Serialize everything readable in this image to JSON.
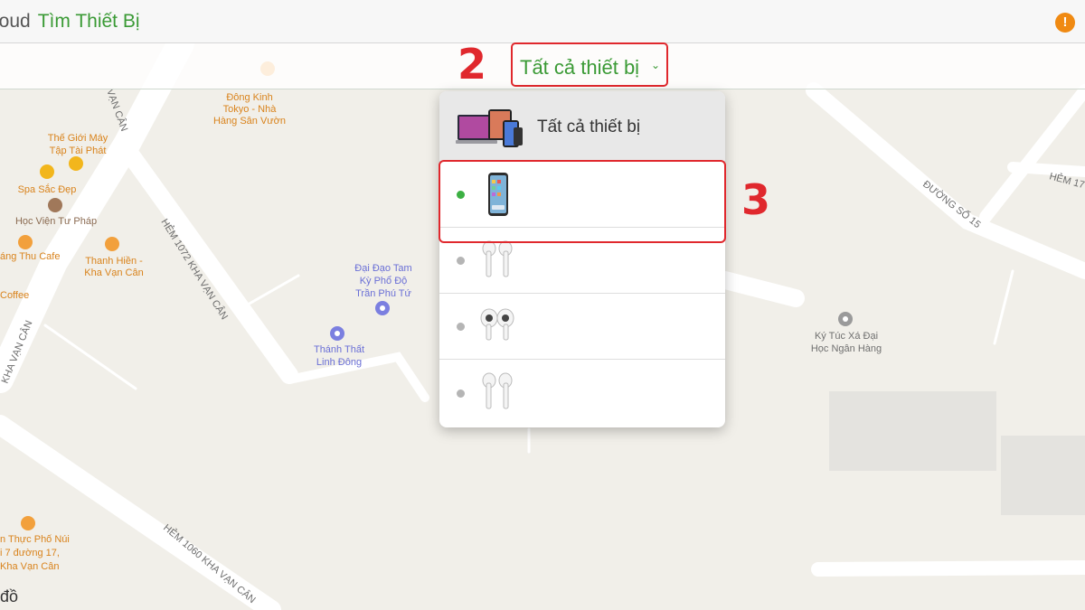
{
  "header": {
    "app_name": "loud",
    "section": "Tìm Thiết Bị",
    "alert_glyph": "!"
  },
  "device_selector": {
    "label": "Tất cả thiết bị",
    "chevron": "⌄"
  },
  "annotations": {
    "step2": "2",
    "step3": "3"
  },
  "dropdown": {
    "all_devices_label": "Tất cả thiết bị",
    "items": [
      {
        "icon": "iphone-icon",
        "status": "online"
      },
      {
        "icon": "airpods-icon",
        "status": "offline"
      },
      {
        "icon": "airpods-pro-icon",
        "status": "offline"
      },
      {
        "icon": "airpods-icon",
        "status": "offline"
      }
    ]
  },
  "map": {
    "places": {
      "dong_kinh_1": "Đông Kinh",
      "dong_kinh_2": "Tokyo - Nhà",
      "dong_kinh_3": "Hàng Sân Vườn",
      "the_gioi_1": "Thế Giới Máy",
      "the_gioi_2": "Tập Tài Phát",
      "spa": "Spa Sắc Đẹp",
      "hoc_vien": "Học Viện Tư Pháp",
      "thu_cafe": "áng Thu Cafe",
      "thanh_hien_1": "Thanh Hiền -",
      "thanh_hien_2": "Kha Vạn Cân",
      "coffee": "Coffee",
      "dai_dao_1": "Đại Đạo Tam",
      "dai_dao_2": "Kỳ Phổ Độ",
      "dai_dao_3": "Trần Phú Tứ",
      "thanh_that_1": "Thánh Thất",
      "thanh_that_2": "Linh Đông",
      "ktx_1": "Ký Túc Xá Đại",
      "ktx_2": "Học Ngân Hàng",
      "am_thuc_1": "n Thực Phố Núi",
      "am_thuc_2": "i 7 đường 17,",
      "am_thuc_3": "Kha Vạn Cân"
    },
    "streets": {
      "hem_1072": "HẺM 1072 KHA VẠN CÂN",
      "hem_1060": "HẺM 1060 KHA VẠN CÂN",
      "duong_15": "ĐƯỜNG SỐ 15",
      "hem_17": "HẺM 17",
      "kha_van_can_left": "KHA VẠN CÂN",
      "van_can_top": "VẠN CÂN"
    },
    "footer": "đồ"
  }
}
